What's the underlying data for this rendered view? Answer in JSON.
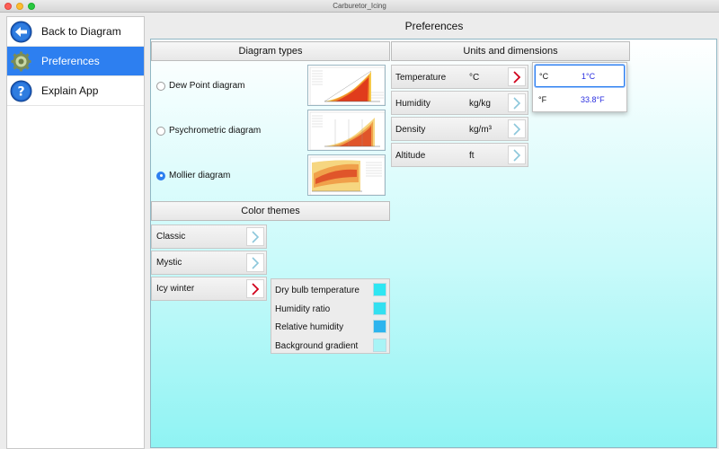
{
  "window": {
    "title": "Carburetor_Icing"
  },
  "sidebar": {
    "items": [
      {
        "label": "Back to Diagram",
        "icon": "back-arrow-icon"
      },
      {
        "label": "Preferences",
        "icon": "preferences-gear-icon"
      },
      {
        "label": "Explain App",
        "icon": "help-question-icon"
      }
    ]
  },
  "page": {
    "title": "Preferences"
  },
  "diagram_types": {
    "header": "Diagram types",
    "options": [
      {
        "label": "Dew Point diagram",
        "selected": false
      },
      {
        "label": "Psychrometric diagram",
        "selected": false
      },
      {
        "label": "Mollier diagram",
        "selected": true
      }
    ]
  },
  "color_themes": {
    "header": "Color themes",
    "themes": [
      {
        "label": "Classic",
        "active": false
      },
      {
        "label": "Mystic",
        "active": false
      },
      {
        "label": "Icy winter",
        "active": true
      }
    ],
    "colors": [
      {
        "label": "Dry bulb temperature",
        "color": "#2ee6f2"
      },
      {
        "label": "Humidity ratio",
        "color": "#33e0f0"
      },
      {
        "label": "Relative humidity",
        "color": "#2db4ee"
      },
      {
        "label": "Background gradient",
        "color": "#a8f4f6"
      }
    ]
  },
  "units": {
    "header": "Units and dimensions",
    "rows": [
      {
        "name": "Temperature",
        "unit": "°C",
        "active": true
      },
      {
        "name": "Humidity",
        "unit": "kg/kg",
        "active": false
      },
      {
        "name": "Density",
        "unit": "kg/m³",
        "active": false
      },
      {
        "name": "Altitude",
        "unit": "ft",
        "active": false
      }
    ]
  },
  "temperature_popup": {
    "options": [
      {
        "unit": "°C",
        "value": "1°C",
        "selected": true
      },
      {
        "unit": "°F",
        "value": "33.8°F",
        "selected": false
      }
    ]
  },
  "colors": {
    "accent": "#2d7ff0",
    "chevron_active": "#d0021b",
    "chevron_inactive": "#8cc7db",
    "value_text": "#2a2ee0"
  }
}
